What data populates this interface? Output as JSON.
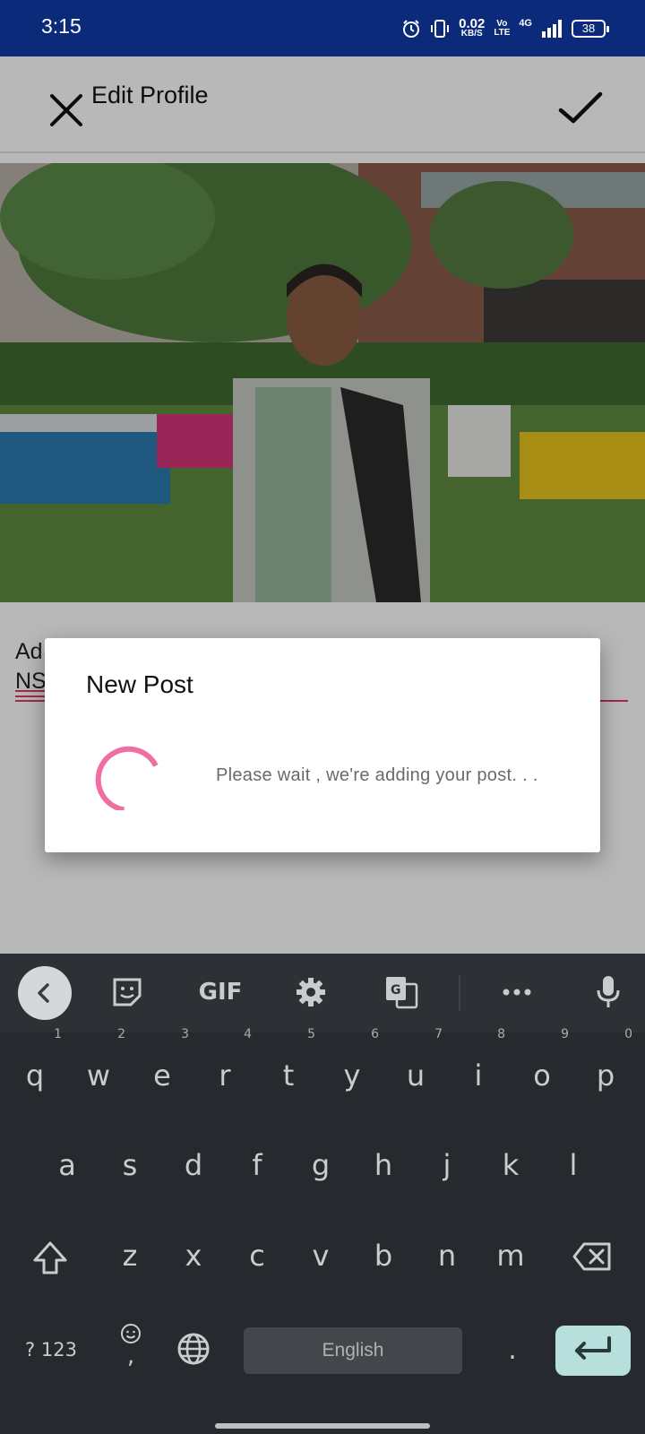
{
  "status_bar": {
    "time": "3:15",
    "net_speed": "0.02",
    "net_speed_unit": "KB/S",
    "volte": "Vo LTE",
    "network": "4G",
    "battery": "38"
  },
  "toolbar": {
    "title": "Edit Profile",
    "close_icon": "close-icon",
    "confirm_icon": "checkmark-icon"
  },
  "form": {
    "field_label": "Ad",
    "field_value": "NS",
    "accent_color": "#e23a6a"
  },
  "dialog": {
    "title": "New Post",
    "message": "Please wait ,  we're adding your post. . .",
    "spinner_color": "#f06ea2"
  },
  "keyboard": {
    "toolbar": {
      "back_icon": "chevron-left-icon",
      "sticker_icon": "sticker-icon",
      "gif_label": "GIF",
      "settings_icon": "gear-icon",
      "translate_icon": "translate-icon",
      "more_icon": "more-dots-icon",
      "mic_icon": "microphone-icon"
    },
    "row1": [
      {
        "key": "q",
        "hint": "1"
      },
      {
        "key": "w",
        "hint": "2"
      },
      {
        "key": "e",
        "hint": "3"
      },
      {
        "key": "r",
        "hint": "4"
      },
      {
        "key": "t",
        "hint": "5"
      },
      {
        "key": "y",
        "hint": "6"
      },
      {
        "key": "u",
        "hint": "7"
      },
      {
        "key": "i",
        "hint": "8"
      },
      {
        "key": "o",
        "hint": "9"
      },
      {
        "key": "p",
        "hint": "0"
      }
    ],
    "row2": [
      "a",
      "s",
      "d",
      "f",
      "g",
      "h",
      "j",
      "k",
      "l"
    ],
    "row3": [
      "z",
      "x",
      "c",
      "v",
      "b",
      "n",
      "m"
    ],
    "symbols_label": "? 123",
    "emoji_comma": ",",
    "space_label": "English",
    "period_label": ".",
    "enter_color": "#b7e0dc"
  }
}
